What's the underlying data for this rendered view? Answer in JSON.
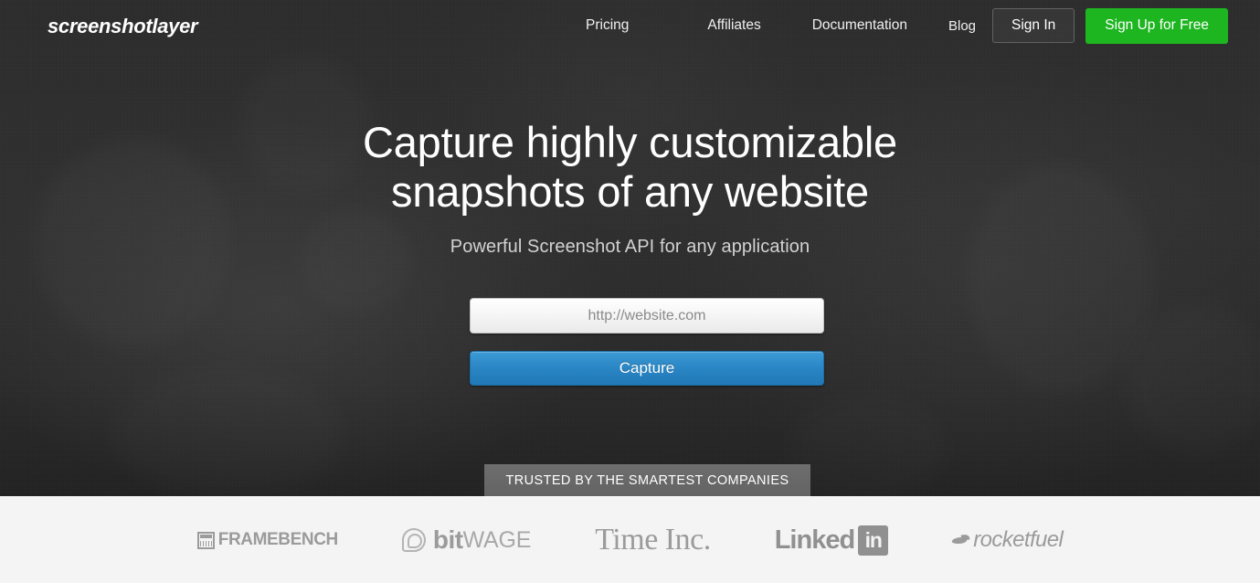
{
  "brand": {
    "logo_text": "screenshotlayer"
  },
  "nav": {
    "links": [
      {
        "label": "Pricing"
      },
      {
        "label": "Affiliates"
      },
      {
        "label": "Documentation"
      },
      {
        "label": "Blog"
      }
    ],
    "sign_in_label": "Sign In",
    "sign_up_label": "Sign Up for Free"
  },
  "hero": {
    "headline_line1": "Capture highly customizable",
    "headline_line2": "snapshots of any website",
    "subheadline": "Powerful Screenshot API for any application",
    "url_input": {
      "value": "",
      "placeholder": "http://website.com"
    },
    "capture_label": "Capture",
    "trusted_badge": "TRUSTED BY THE SMARTEST COMPANIES"
  },
  "clients": {
    "framebench": {
      "name": "FRAMEBENCH",
      "icon": "window-grid-icon"
    },
    "bitwage": {
      "bold": "bit",
      "light": "WAGE",
      "icon": "spiral-b-icon"
    },
    "timeinc": {
      "name": "Time Inc."
    },
    "linkedin": {
      "word": "Linked",
      "box": "in"
    },
    "rocketfuel": {
      "name": "rocketfuel",
      "icon": "bird-swoosh-icon"
    }
  },
  "colors": {
    "hero_bg": "#2a2a2a",
    "accent_green": "#1db520",
    "accent_blue": "#2a85c4",
    "strip_bg": "#f4f4f4",
    "badge_gray": "#6b6b6b",
    "logo_gray": "#9b9b9b"
  }
}
